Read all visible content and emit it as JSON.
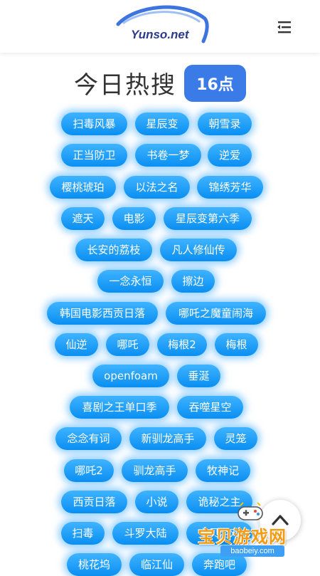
{
  "header": {
    "logo_text": "Yunso.net",
    "menu_icon": "menu-collapse-icon"
  },
  "heading": {
    "title": "今日热搜",
    "hour_badge": "16点"
  },
  "tags": [
    "扫毒风暴",
    "星辰变",
    "朝雪录",
    "正当防卫",
    "书卷一梦",
    "逆爱",
    "樱桃琥珀",
    "以法之名",
    "锦绣芳华",
    "遮天",
    "电影",
    "星辰变第六季",
    "长安的荔枝",
    "凡人修仙传",
    "一念永恒",
    "擦边",
    "韩国电影西贡日落",
    "哪吒之魔童闹海",
    "仙逆",
    "哪吒",
    "梅根2",
    "梅根",
    "openfoam",
    "垂涎",
    "喜剧之王单口季",
    "吞噬星空",
    "念念有词",
    "新驯龙高手",
    "灵笼",
    "哪吒2",
    "驯龙高手",
    "牧神记",
    "西贡日落",
    "小说",
    "诡秘之主",
    "扫毒",
    "斗罗大陆",
    "宝贝游戏",
    "桃花坞",
    "临江仙",
    "奔跑吧"
  ],
  "back_to_top": {
    "icon": "chevron-up-icon"
  },
  "watermark": {
    "text": "宝贝游戏网",
    "url": "baobeiy.com",
    "icon": "gamepad-icon"
  },
  "colors": {
    "tag_bg": "#0a8ff2",
    "badge_bg": "#3a7be8",
    "title": "#333333"
  }
}
